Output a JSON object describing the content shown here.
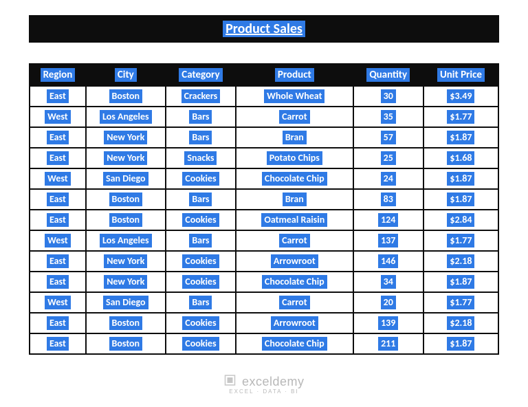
{
  "title": "Product Sales",
  "columns": [
    "Region",
    "City",
    "Category",
    "Product",
    "Quantity",
    "Unit Price"
  ],
  "rows": [
    {
      "region": "East",
      "city": "Boston",
      "category": "Crackers",
      "product": "Whole Wheat",
      "quantity": "30",
      "unit_price": "$3.49"
    },
    {
      "region": "West",
      "city": "Los Angeles",
      "category": "Bars",
      "product": "Carrot",
      "quantity": "35",
      "unit_price": "$1.77"
    },
    {
      "region": "East",
      "city": "New York",
      "category": "Bars",
      "product": "Bran",
      "quantity": "57",
      "unit_price": "$1.87"
    },
    {
      "region": "East",
      "city": "New York",
      "category": "Snacks",
      "product": "Potato Chips",
      "quantity": "25",
      "unit_price": "$1.68"
    },
    {
      "region": "West",
      "city": "San Diego",
      "category": "Cookies",
      "product": "Chocolate Chip",
      "quantity": "24",
      "unit_price": "$1.87"
    },
    {
      "region": "East",
      "city": "Boston",
      "category": "Bars",
      "product": "Bran",
      "quantity": "83",
      "unit_price": "$1.87"
    },
    {
      "region": "East",
      "city": "Boston",
      "category": "Cookies",
      "product": "Oatmeal Raisin",
      "quantity": "124",
      "unit_price": "$2.84"
    },
    {
      "region": "West",
      "city": "Los Angeles",
      "category": "Bars",
      "product": "Carrot",
      "quantity": "137",
      "unit_price": "$1.77"
    },
    {
      "region": "East",
      "city": "New York",
      "category": "Cookies",
      "product": "Arrowroot",
      "quantity": "146",
      "unit_price": "$2.18"
    },
    {
      "region": "East",
      "city": "New York",
      "category": "Cookies",
      "product": "Chocolate Chip",
      "quantity": "34",
      "unit_price": "$1.87"
    },
    {
      "region": "West",
      "city": "San Diego",
      "category": "Bars",
      "product": "Carrot",
      "quantity": "20",
      "unit_price": "$1.77"
    },
    {
      "region": "East",
      "city": "Boston",
      "category": "Cookies",
      "product": "Arrowroot",
      "quantity": "139",
      "unit_price": "$2.18"
    },
    {
      "region": "East",
      "city": "Boston",
      "category": "Cookies",
      "product": "Chocolate Chip",
      "quantity": "211",
      "unit_price": "$1.87"
    }
  ],
  "watermark": {
    "brand": "exceldemy",
    "tagline": "EXCEL · DATA · BI"
  }
}
